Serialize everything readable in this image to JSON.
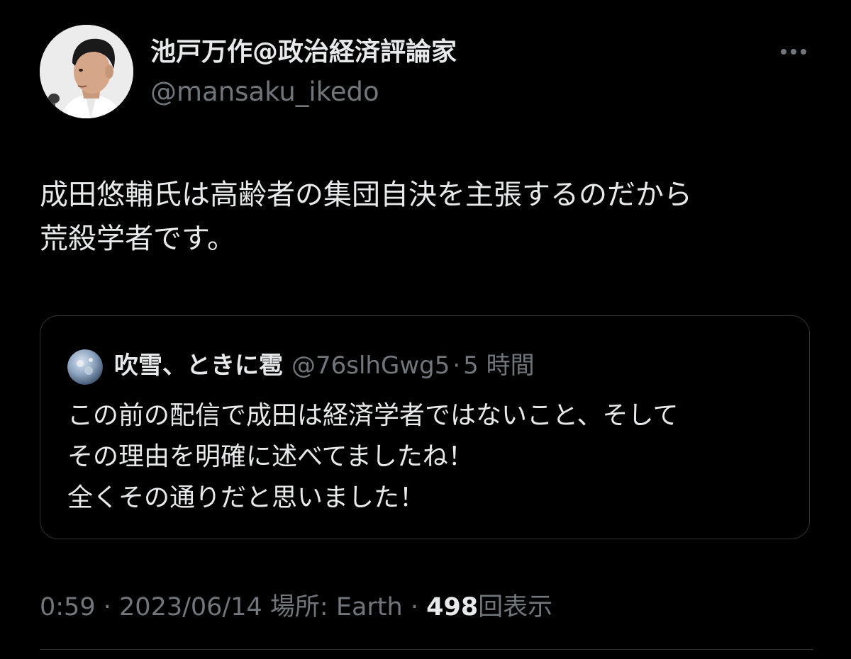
{
  "tweet": {
    "author": {
      "display_name": "池戸万作@政治経済評論家",
      "handle": "@mansaku_ikedo"
    },
    "text_lines": [
      "成田悠輔氏は高齢者の集団自決を主張するのだから",
      "荒殺学者です。"
    ],
    "quote": {
      "display_name": "吹雪、ときに雹",
      "handle": "@76slhGwg5",
      "separator": "·",
      "time": "5 時間",
      "text_lines": [
        "この前の配信で成田は経済学者ではないこと、そして",
        "その理由を明確に述べてましたね！",
        "全くその通りだと思いました！"
      ]
    },
    "meta": {
      "time": "0:59",
      "sep1": "·",
      "date": "2023/06/14",
      "location": "場所: Earth",
      "sep2": "·",
      "views_count": "498",
      "views_label": "回表示"
    }
  },
  "icons": {
    "more": "more-horizontal-icon",
    "author_avatar": "profile-avatar",
    "quote_avatar": "quote-profile-avatar"
  },
  "colors": {
    "background": "#000000",
    "primary_text": "#e7e9ea",
    "secondary_text": "#71767b",
    "border": "#2f3336"
  }
}
